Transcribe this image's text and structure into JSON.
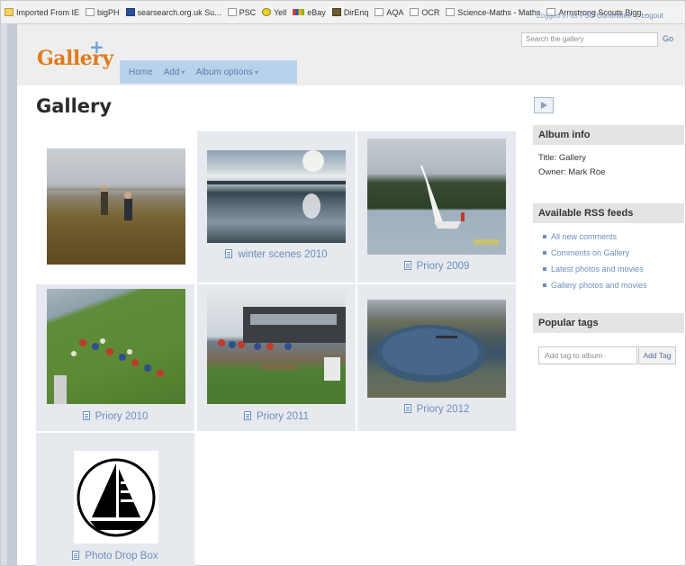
{
  "bookmarks": [
    {
      "label": "Imported From IE",
      "icon": "folder-icon"
    },
    {
      "label": "bigPH",
      "icon": "page-icon"
    },
    {
      "label": "searsearch.org.uk Su...",
      "icon": "site-icon"
    },
    {
      "label": "PSC",
      "icon": "page-icon"
    },
    {
      "label": "Yell",
      "icon": "smiley-icon"
    },
    {
      "label": "eBay",
      "icon": "ebay-icon"
    },
    {
      "label": "DirEnq",
      "icon": "page-icon"
    },
    {
      "label": "AQA",
      "icon": "page-icon"
    },
    {
      "label": "OCR",
      "icon": "page-icon"
    },
    {
      "label": "Science-Maths - Maths",
      "icon": "page-icon"
    },
    {
      "label": "Armstrong Scouts Bigg...",
      "icon": "page-icon"
    }
  ],
  "header": {
    "logo": "Gallery",
    "nav": [
      {
        "label": "Home",
        "dropdown": ""
      },
      {
        "label": "Add",
        "dropdown": "▾"
      },
      {
        "label": "Album options",
        "dropdown": "▾"
      }
    ],
    "login_prefix": "Logged in as",
    "login_user": "PSC Committee",
    "logout": "Logout",
    "search_placeholder": "Search the gallery",
    "search_go": "Go"
  },
  "page_title": "Gallery",
  "albums": [
    {
      "title": ""
    },
    {
      "title": "winter scenes 2010"
    },
    {
      "title": "Priory 2009"
    },
    {
      "title": "Priory 2010"
    },
    {
      "title": "Priory 2011"
    },
    {
      "title": "Priory 2012"
    },
    {
      "title": "Photo Drop Box"
    }
  ],
  "sidebar": {
    "album_info_heading": "Album info",
    "title_line": "Title: Gallery",
    "owner_line": "Owner: Mark Roe",
    "rss_heading": "Available RSS feeds",
    "rss_links": [
      "All new comments",
      "Comments on Gallery",
      "Latest photos and movies",
      "Gallery photos and movies"
    ],
    "tags_heading": "Popular tags",
    "tag_placeholder": "Add tag to album",
    "tag_button": "Add Tag"
  },
  "colors": {
    "logo": "#e07b1b",
    "nav_bg": "#b9d2ec",
    "link": "#6b8fc0",
    "cell_bg": "#e6e9ee"
  }
}
